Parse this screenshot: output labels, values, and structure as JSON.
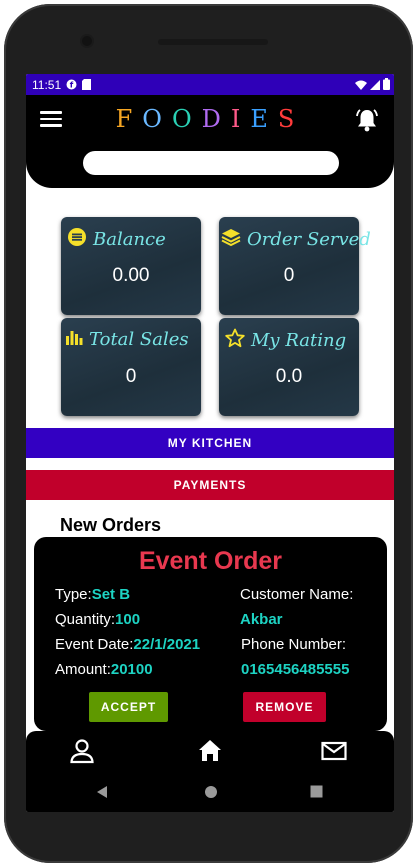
{
  "status_bar": {
    "time": "11:51",
    "icons": [
      "notification-icon",
      "sd-card-icon",
      "wifi-icon",
      "signal-icon",
      "battery-icon"
    ]
  },
  "app_bar": {
    "title_letters": [
      "F",
      "O",
      "O",
      "D",
      "I",
      "E",
      "S"
    ],
    "title_colors": [
      "#f6a623",
      "#6ab8ff",
      "#2ad0b4",
      "#b06bf0",
      "#ff5a8a",
      "#3aa0ff",
      "#ff3b3b"
    ],
    "menu_icon": "menu-icon",
    "bell_icon": "bell-icon",
    "search": {
      "value": "",
      "placeholder": ""
    }
  },
  "stats": [
    {
      "label": "Balance",
      "value": "0.00",
      "icon": "coin-icon"
    },
    {
      "label": "Order Served",
      "value": "0",
      "icon": "layers-icon"
    },
    {
      "label": "Total Sales",
      "value": "0",
      "icon": "bar-chart-icon"
    },
    {
      "label": "My Rating",
      "value": "0.0",
      "icon": "star-icon"
    }
  ],
  "buttons": {
    "my_kitchen": "MY KITCHEN",
    "payments": "PAYMENTS"
  },
  "colors": {
    "my_kitchen": "#3300c2",
    "payments": "#c1002b",
    "accept": "#5f9900",
    "remove": "#c1002b",
    "value_text": "#1dd3c3",
    "title_red": "#e8384f",
    "stat_text": "#79e5e6"
  },
  "new_orders": {
    "heading": "New Orders",
    "order": {
      "title": "Event Order",
      "type_label": "Type:",
      "type_value": "Set B",
      "quantity_label": "Quantity:",
      "quantity_value": "100",
      "event_date_label": "Event Date:",
      "event_date_value": "22/1/2021",
      "amount_label": "Amount:",
      "amount_value": "20100",
      "customer_label": "Customer Name:",
      "customer_value": "Akbar",
      "phone_label": "Phone Number:",
      "phone_value": "0165456485555",
      "accept": "ACCEPT",
      "remove": "REMOVE"
    }
  },
  "bottom_nav": [
    "profile-icon",
    "home-icon",
    "mail-icon"
  ],
  "system_nav": [
    "back-icon",
    "home-circle-icon",
    "recents-icon"
  ]
}
